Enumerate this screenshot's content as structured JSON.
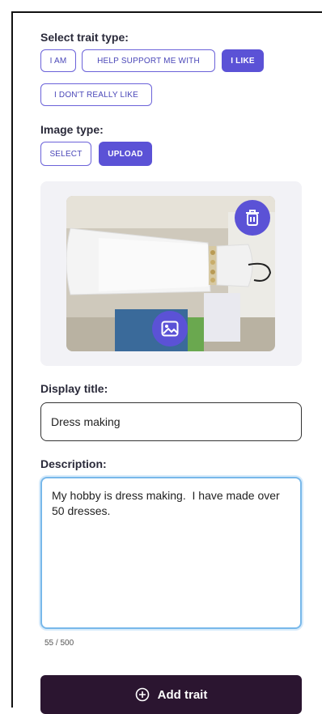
{
  "trait_type": {
    "label": "Select trait type:",
    "options": [
      {
        "label": "I AM",
        "active": false
      },
      {
        "label": "HELP SUPPORT ME WITH",
        "active": false
      },
      {
        "label": "I LIKE",
        "active": true
      },
      {
        "label": "I DON'T REALLY LIKE",
        "active": false
      }
    ]
  },
  "image_type": {
    "label": "Image type:",
    "options": [
      {
        "label": "SELECT",
        "active": false
      },
      {
        "label": "UPLOAD",
        "active": true
      }
    ]
  },
  "image": {
    "delete_icon": "trash-icon",
    "replace_icon": "image-icon"
  },
  "display_title": {
    "label": "Display title:",
    "value": "Dress making"
  },
  "description": {
    "label": "Description:",
    "value": "My hobby is dress making.  I have made over 50 dresses.",
    "counter": "55 / 500"
  },
  "submit": {
    "label": "Add trait",
    "icon": "plus-circle-icon"
  },
  "colors": {
    "accent": "#5b52d6",
    "submit_bg": "#2b1530",
    "focus_border": "#78b8ea"
  }
}
